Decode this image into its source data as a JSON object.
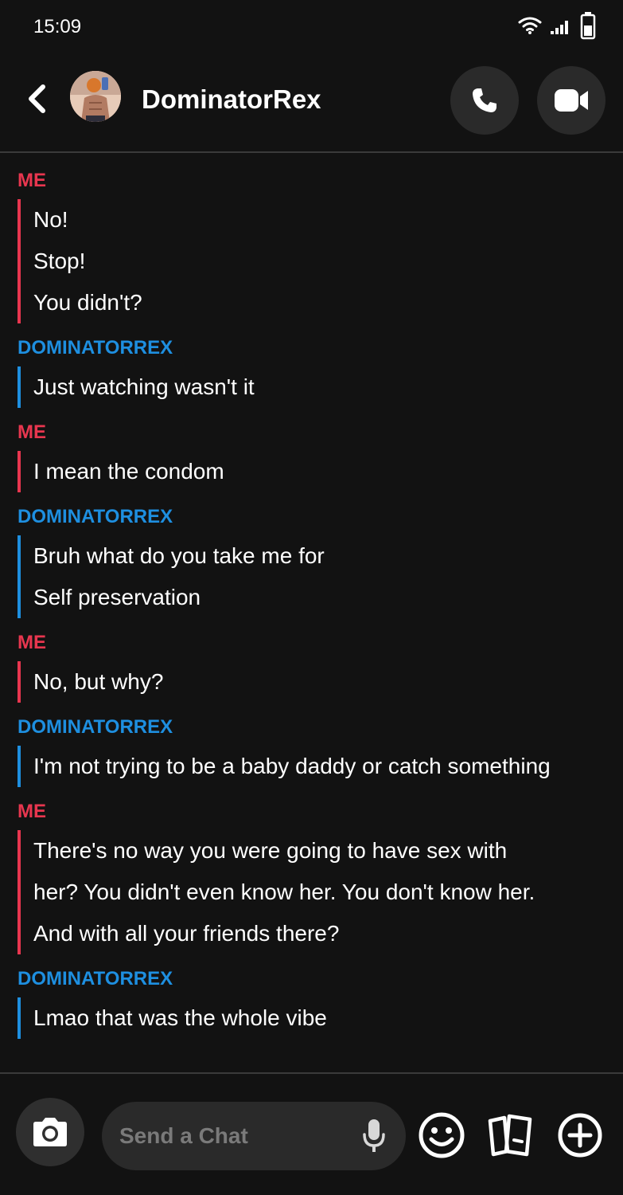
{
  "status_bar": {
    "time": "15:09"
  },
  "header": {
    "contact_name": "DominatorRex"
  },
  "messages": [
    {
      "sender": "ME",
      "side": "me",
      "lines": [
        "No!",
        "Stop!",
        "You didn't?"
      ]
    },
    {
      "sender": "DOMINATORREX",
      "side": "them",
      "lines": [
        "Just watching wasn't it"
      ]
    },
    {
      "sender": "ME",
      "side": "me",
      "lines": [
        "I mean the condom"
      ]
    },
    {
      "sender": "DOMINATORREX",
      "side": "them",
      "lines": [
        "Bruh what do you take me for",
        "Self preservation"
      ]
    },
    {
      "sender": "ME",
      "side": "me",
      "lines": [
        "No, but why?"
      ]
    },
    {
      "sender": "DOMINATORREX",
      "side": "them",
      "lines": [
        "I'm not trying to be a baby daddy or catch something"
      ]
    },
    {
      "sender": "ME",
      "side": "me",
      "lines": [
        "There's no way you were going to have sex with",
        "her? You didn't even know her. You don't know her.",
        "And with all your friends there?"
      ]
    },
    {
      "sender": "DOMINATORREX",
      "side": "them",
      "lines": [
        "Lmao that was the whole vibe"
      ]
    }
  ],
  "input": {
    "placeholder": "Send a Chat",
    "value": ""
  },
  "colors": {
    "me": "#e8364f",
    "them": "#1e8fe0",
    "background": "#121212"
  },
  "icons": {
    "back": "chevron-left-icon",
    "call": "phone-icon",
    "video": "video-camera-icon",
    "camera": "camera-icon",
    "mic": "microphone-icon",
    "emoji": "smiley-icon",
    "cards": "cards-icon",
    "plus": "plus-circle-icon"
  }
}
